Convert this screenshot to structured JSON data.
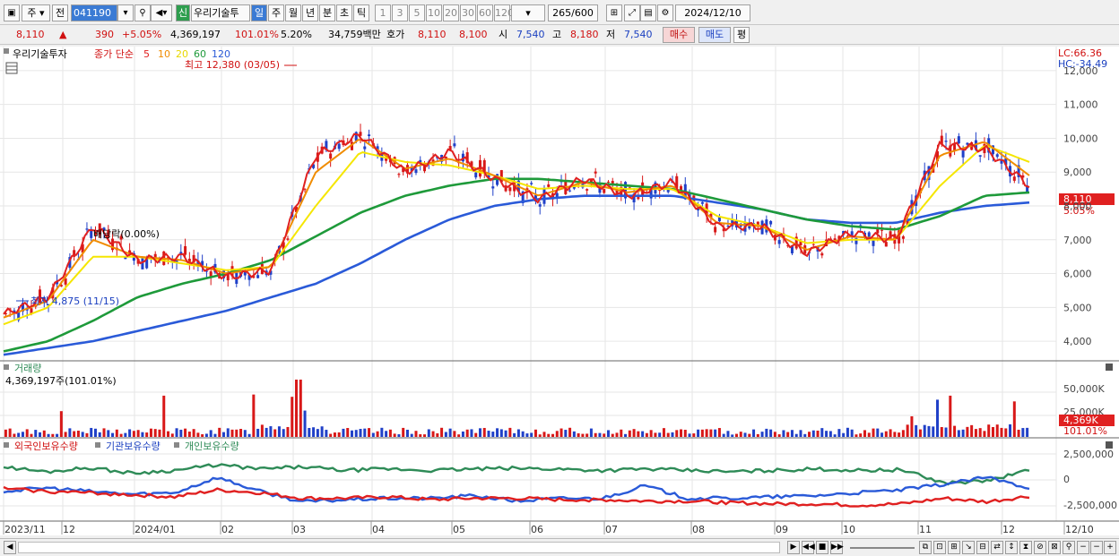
{
  "toolbar": {
    "market": "주",
    "prefix": "전",
    "code": "041190",
    "signal_badge": "신",
    "stock_name": "우리기술투",
    "periods": [
      "일",
      "주",
      "월",
      "년",
      "분",
      "초",
      "틱"
    ],
    "active_period": "일",
    "minutes": [
      "1",
      "3",
      "5",
      "10",
      "20",
      "30",
      "60",
      "120"
    ],
    "count": "265",
    "count_total": "/600",
    "date": "2024/12/10"
  },
  "quote": {
    "price": "8,110",
    "change": "390",
    "change_pct": "+5.05%",
    "volume": "4,369,197",
    "volume_ratio": "101.01%",
    "turnover": "5.20%",
    "amount": "34,759백만",
    "ask_label": "호가",
    "ask": "8,110",
    "bid": "8,100",
    "open_label": "시",
    "open": "7,540",
    "high_label": "고",
    "high": "8,180",
    "low_label": "저",
    "low": "7,540",
    "buy_label": "매수",
    "sell_label": "매도",
    "eval_label": "평"
  },
  "price_panel": {
    "title": "우리기술투자",
    "ma_label": "종가 단순",
    "ma_periods": [
      "5",
      "10",
      "20",
      "60",
      "120"
    ],
    "ma_colors": [
      "#e02020",
      "#f08c00",
      "#f5e600",
      "#1e9a3a",
      "#2a5ad8"
    ],
    "high_note": "최고 12,380 (03/05)",
    "low_note": "최저 4,875 (11/15)",
    "dividend_note": "배당락(0.00%)",
    "lc": "LC:66.36",
    "hc": "HC:-34.49",
    "current_price_tag": "8,110",
    "current_pct_tag": "5.05%",
    "y_ticks": [
      "12,000",
      "11,000",
      "10,000",
      "9,000",
      "8,000",
      "7,000",
      "6,000",
      "5,000",
      "4,000"
    ]
  },
  "volume_panel": {
    "title": "거래량",
    "value": "4,369,197주(101.01%)",
    "y_ticks": [
      "50,000K",
      "25,000K"
    ],
    "current_tag": "4,369K",
    "current_pct": "101.01%"
  },
  "holding_panel": {
    "labels": [
      "외국인보유수량",
      "기관보유수량",
      "개인보유수량"
    ],
    "colors": [
      "#e02020",
      "#2a5ad8",
      "#2e8b57"
    ],
    "y_ticks": [
      "2,500,000",
      "0",
      "-2,500,000"
    ]
  },
  "x_axis": {
    "labels": [
      "2023/11",
      "12",
      "2024/01",
      "02",
      "03",
      "04",
      "05",
      "06",
      "07",
      "08",
      "09",
      "10",
      "11",
      "12",
      "12/10"
    ]
  },
  "chart_data": {
    "type": "candlestick",
    "title": "우리기술투자",
    "ylim": [
      3500,
      12500
    ],
    "ma_series": [
      {
        "name": "5",
        "values": [
          4800,
          5300,
          7400,
          6400,
          6500,
          5900,
          6100,
          9500,
          10100,
          9000,
          9600,
          8800,
          8200,
          8800,
          8300,
          8700,
          7400,
          7400,
          6600,
          7200,
          7000,
          9800,
          9700,
          8600
        ]
      },
      {
        "name": "10",
        "values": [
          4700,
          5200,
          7000,
          6500,
          6400,
          6000,
          6200,
          9000,
          10000,
          9100,
          9400,
          8900,
          8300,
          8700,
          8400,
          8600,
          7500,
          7400,
          6700,
          7100,
          7000,
          9500,
          9900,
          8900
        ]
      },
      {
        "name": "20",
        "values": [
          4500,
          5000,
          6500,
          6500,
          6300,
          6100,
          6200,
          8000,
          9600,
          9300,
          9200,
          8900,
          8500,
          8600,
          8500,
          8500,
          7700,
          7400,
          6900,
          7000,
          7000,
          8600,
          9800,
          9300
        ]
      },
      {
        "name": "60",
        "values": [
          3700,
          4000,
          4600,
          5300,
          5700,
          6000,
          6400,
          7100,
          7800,
          8300,
          8600,
          8800,
          8800,
          8700,
          8600,
          8500,
          8200,
          7900,
          7600,
          7400,
          7300,
          7700,
          8300,
          8400
        ]
      },
      {
        "name": "120",
        "values": [
          3600,
          3800,
          4000,
          4300,
          4600,
          4900,
          5300,
          5700,
          6300,
          7000,
          7600,
          8000,
          8200,
          8300,
          8300,
          8300,
          8100,
          7900,
          7600,
          7500,
          7500,
          7800,
          8000,
          8100
        ]
      }
    ],
    "volume_peaks": [
      {
        "label": "03",
        "value": 60000
      },
      {
        "label": "11",
        "value": 40000
      },
      {
        "label": "12",
        "value": 35000
      }
    ]
  }
}
